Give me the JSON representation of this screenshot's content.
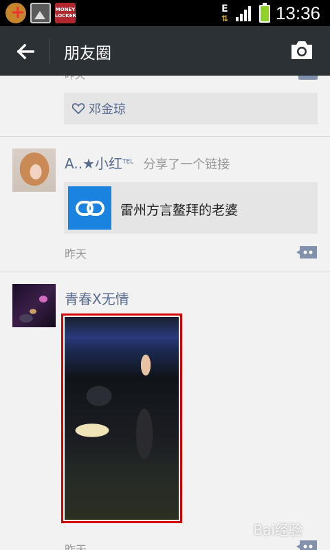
{
  "status_bar": {
    "time": "13:36",
    "network_type": "E",
    "icons": [
      "app-plus-icon",
      "gallery-icon",
      "money-locker-icon"
    ],
    "money_locker_label": "MONEY LOCKER",
    "battery_color": "#8fd12a"
  },
  "nav": {
    "title": "朋友圈",
    "back_icon": "arrow-left-icon",
    "camera_icon": "camera-icon",
    "bar_color": "#2c3135"
  },
  "feed": {
    "partial_post": {
      "time": "昨天",
      "liked_by": "邓金琼"
    },
    "posts": [
      {
        "username": "A..★小红",
        "username_sup": "TEL",
        "action": "分享了一个链接",
        "link_title": "雷州方言鳌拜的老婆",
        "time": "昨天"
      },
      {
        "username": "青春X无情",
        "time": "昨天"
      }
    ]
  },
  "watermark": "Bai经验",
  "colors": {
    "username": "#556a8e",
    "link_blue": "#1a83e0",
    "highlight_border": "#d40000"
  }
}
